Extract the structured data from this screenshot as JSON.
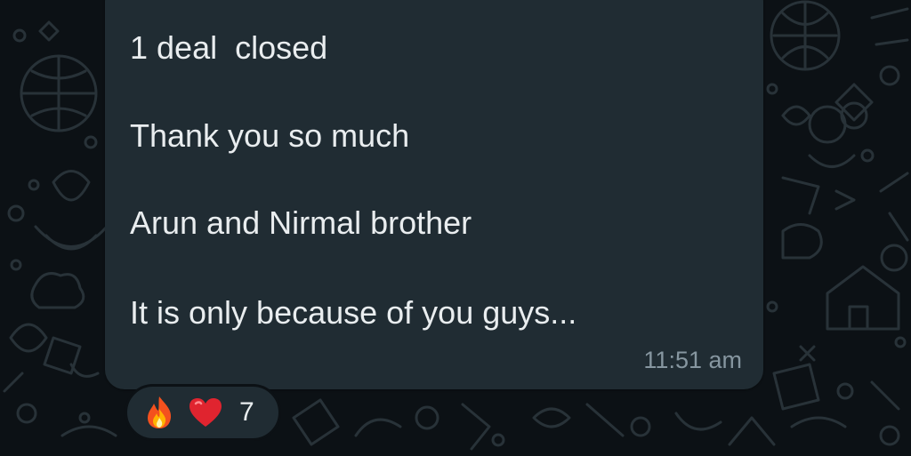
{
  "message": {
    "lines": [
      "1 deal  closed",
      "Thank you so much",
      "Arun and Nirmal brother",
      "It is only because of you guys..."
    ],
    "time": "11:51 am"
  },
  "reactions": {
    "items": [
      {
        "emoji": "fire-icon"
      },
      {
        "emoji": "heart-icon"
      }
    ],
    "count": "7"
  },
  "colors": {
    "background": "#0c1115",
    "bubble": "#202c33",
    "text": "#e9edef",
    "meta": "#8696a0",
    "doodle": "#2a3439"
  }
}
